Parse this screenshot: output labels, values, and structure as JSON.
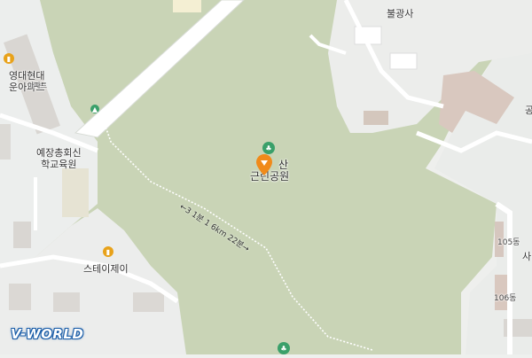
{
  "map": {
    "labels": {
      "temple": "불광사",
      "apartment": "영대현대\n운아파트",
      "school": "예장총회신\n학교육원",
      "stay": "스테이제이",
      "park": "\n근린공원",
      "park_top": "산",
      "bldg105": "105동",
      "bldg106": "106동",
      "partial_right": "사",
      "partial_gong": "공",
      "apt_sign": "아파트"
    },
    "route_label": "←3 1분 1 6km 22분→",
    "logo": "V-WORLD",
    "colors": {
      "park": "#c9d4b6",
      "pin": "#f08a1a",
      "poi_green": "#3aa06a",
      "poi_orange": "#e8a21a",
      "road": "#ffffff"
    }
  }
}
